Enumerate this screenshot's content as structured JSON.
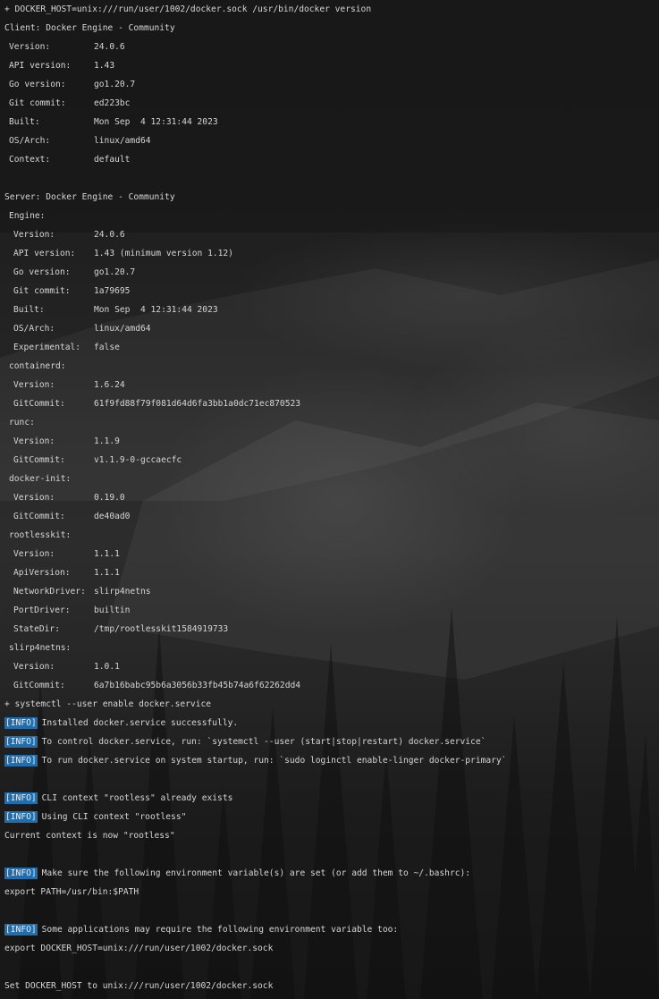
{
  "colors": {
    "text": "#d6d6d6",
    "info_tag_bg": "#1f6fb0",
    "background": "#1c1c1c"
  },
  "lines": [
    {
      "type": "text",
      "text": "+ DOCKER_HOST=unix:///run/user/1002/docker.sock /usr/bin/docker version"
    },
    {
      "type": "text",
      "text": "Client: Docker Engine - Community"
    },
    {
      "type": "kv",
      "indent": 1,
      "key": "Version:",
      "value": "24.0.6"
    },
    {
      "type": "kv",
      "indent": 1,
      "key": "API version:",
      "value": "1.43"
    },
    {
      "type": "kv",
      "indent": 1,
      "key": "Go version:",
      "value": "go1.20.7"
    },
    {
      "type": "kv",
      "indent": 1,
      "key": "Git commit:",
      "value": "ed223bc"
    },
    {
      "type": "kv",
      "indent": 1,
      "key": "Built:",
      "value": "Mon Sep  4 12:31:44 2023"
    },
    {
      "type": "kv",
      "indent": 1,
      "key": "OS/Arch:",
      "value": "linux/amd64"
    },
    {
      "type": "kv",
      "indent": 1,
      "key": "Context:",
      "value": "default"
    },
    {
      "type": "blank"
    },
    {
      "type": "text",
      "text": "Server: Docker Engine - Community"
    },
    {
      "type": "section",
      "text": "Engine:"
    },
    {
      "type": "kv",
      "indent": 2,
      "key": "Version:",
      "value": "24.0.6"
    },
    {
      "type": "kv",
      "indent": 2,
      "key": "API version:",
      "value": "1.43 (minimum version 1.12)"
    },
    {
      "type": "kv",
      "indent": 2,
      "key": "Go version:",
      "value": "go1.20.7"
    },
    {
      "type": "kv",
      "indent": 2,
      "key": "Git commit:",
      "value": "1a79695"
    },
    {
      "type": "kv",
      "indent": 2,
      "key": "Built:",
      "value": "Mon Sep  4 12:31:44 2023"
    },
    {
      "type": "kv",
      "indent": 2,
      "key": "OS/Arch:",
      "value": "linux/amd64"
    },
    {
      "type": "kv",
      "indent": 2,
      "key": "Experimental:",
      "value": "false"
    },
    {
      "type": "section",
      "text": "containerd:"
    },
    {
      "type": "kv",
      "indent": 2,
      "key": "Version:",
      "value": "1.6.24"
    },
    {
      "type": "kv",
      "indent": 2,
      "key": "GitCommit:",
      "value": "61f9fd88f79f081d64d6fa3bb1a0dc71ec870523"
    },
    {
      "type": "section",
      "text": "runc:"
    },
    {
      "type": "kv",
      "indent": 2,
      "key": "Version:",
      "value": "1.1.9"
    },
    {
      "type": "kv",
      "indent": 2,
      "key": "GitCommit:",
      "value": "v1.1.9-0-gccaecfc"
    },
    {
      "type": "section",
      "text": "docker-init:"
    },
    {
      "type": "kv",
      "indent": 2,
      "key": "Version:",
      "value": "0.19.0"
    },
    {
      "type": "kv",
      "indent": 2,
      "key": "GitCommit:",
      "value": "de40ad0"
    },
    {
      "type": "section",
      "text": "rootlesskit:"
    },
    {
      "type": "kv",
      "indent": 2,
      "key": "Version:",
      "value": "1.1.1"
    },
    {
      "type": "kv",
      "indent": 2,
      "key": "ApiVersion:",
      "value": "1.1.1"
    },
    {
      "type": "kv",
      "indent": 2,
      "key": "NetworkDriver:",
      "value": "slirp4netns"
    },
    {
      "type": "kv",
      "indent": 2,
      "key": "PortDriver:",
      "value": "builtin"
    },
    {
      "type": "kv",
      "indent": 2,
      "key": "StateDir:",
      "value": "/tmp/rootlesskit1584919733"
    },
    {
      "type": "section",
      "text": "slirp4netns:"
    },
    {
      "type": "kv",
      "indent": 2,
      "key": "Version:",
      "value": "1.0.1"
    },
    {
      "type": "kv",
      "indent": 2,
      "key": "GitCommit:",
      "value": "6a7b16babc95b6a3056b33fb45b74a6f62262dd4"
    },
    {
      "type": "text",
      "text": "+ systemctl --user enable docker.service"
    },
    {
      "type": "info",
      "tag": "[INFO]",
      "text": "Installed docker.service successfully."
    },
    {
      "type": "info",
      "tag": "[INFO]",
      "text": "To control docker.service, run: `systemctl --user (start|stop|restart) docker.service`"
    },
    {
      "type": "info",
      "tag": "[INFO]",
      "text": "To run docker.service on system startup, run: `sudo loginctl enable-linger docker-primary`"
    },
    {
      "type": "blank"
    },
    {
      "type": "info",
      "tag": "[INFO]",
      "text": "CLI context \"rootless\" already exists"
    },
    {
      "type": "info",
      "tag": "[INFO]",
      "text": "Using CLI context \"rootless\""
    },
    {
      "type": "text",
      "text": "Current context is now \"rootless\""
    },
    {
      "type": "blank"
    },
    {
      "type": "info",
      "tag": "[INFO]",
      "text": "Make sure the following environment variable(s) are set (or add them to ~/.bashrc):"
    },
    {
      "type": "text",
      "text": "export PATH=/usr/bin:$PATH"
    },
    {
      "type": "blank"
    },
    {
      "type": "info",
      "tag": "[INFO]",
      "text": "Some applications may require the following environment variable too:"
    },
    {
      "type": "text",
      "text": "export DOCKER_HOST=unix:///run/user/1002/docker.sock"
    },
    {
      "type": "blank"
    },
    {
      "type": "text",
      "text": "Set DOCKER_HOST to unix:///run/user/1002/docker.sock"
    }
  ]
}
